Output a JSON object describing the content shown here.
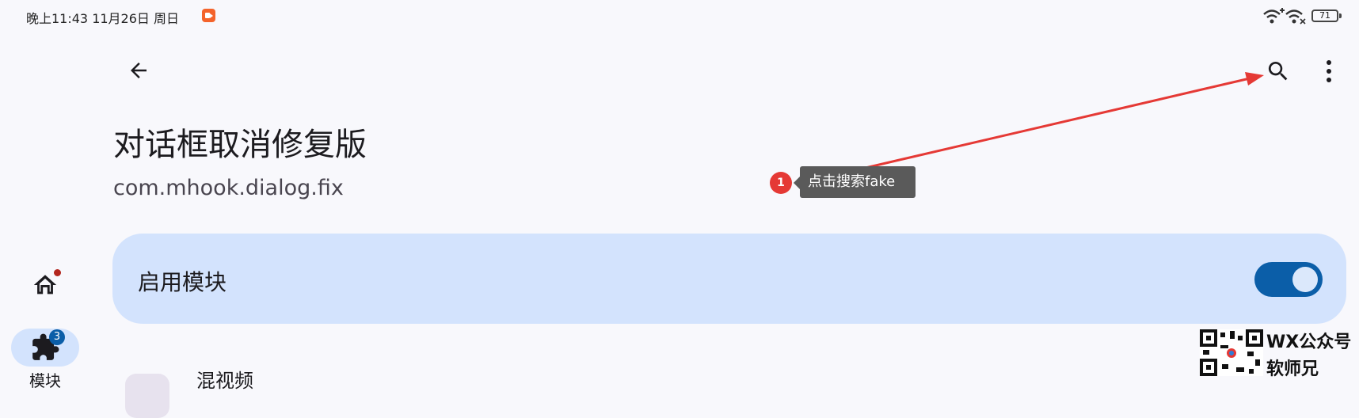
{
  "status_bar": {
    "time": "晚上11:43  11月26日 周日",
    "battery": "71",
    "icons": [
      "screen-record-icon",
      "wifi-plus-icon",
      "wifi-icon",
      "battery-icon"
    ]
  },
  "app_bar": {
    "icons": [
      "back-arrow-icon",
      "search-icon",
      "more-vert-icon"
    ]
  },
  "module": {
    "title": "对话框取消修复版",
    "package": "com.mhook.dialog.fix"
  },
  "enable_card": {
    "label": "启用模块",
    "enabled": true
  },
  "nav_rail": {
    "home_icon": "home-icon",
    "home_has_dot": true,
    "modules_icon": "puzzle-icon",
    "modules_badge": "3",
    "modules_label": "模块"
  },
  "next_item": {
    "title": "混视频"
  },
  "annotation": {
    "step": "1",
    "text": "点击搜索fake",
    "color": "#e53935"
  },
  "watermark": {
    "line1": "WX公众号",
    "line2": "软师兄"
  },
  "colors": {
    "card_bg": "#d3e3fd",
    "switch_on": "#0b5ea8",
    "badge_red": "#b3261e"
  }
}
